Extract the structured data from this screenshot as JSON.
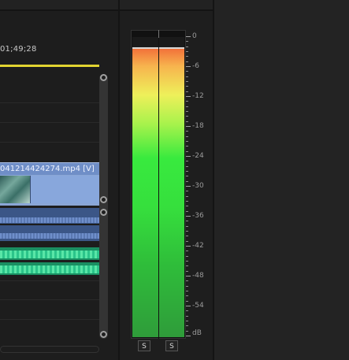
{
  "timeline": {
    "timecode": "01;49;28",
    "video_clip_title": "041214424274.mp4 [V]"
  },
  "audio_meter": {
    "scale_labels": [
      "0",
      "-6",
      "-12",
      "-18",
      "-24",
      "-30",
      "-36",
      "-42",
      "-48",
      "-54",
      "dB"
    ],
    "solo_left": "S",
    "solo_right": "S",
    "colors": {
      "hot": "#f2723a",
      "mid": "#eef05a",
      "safe": "#36df3d"
    }
  }
}
